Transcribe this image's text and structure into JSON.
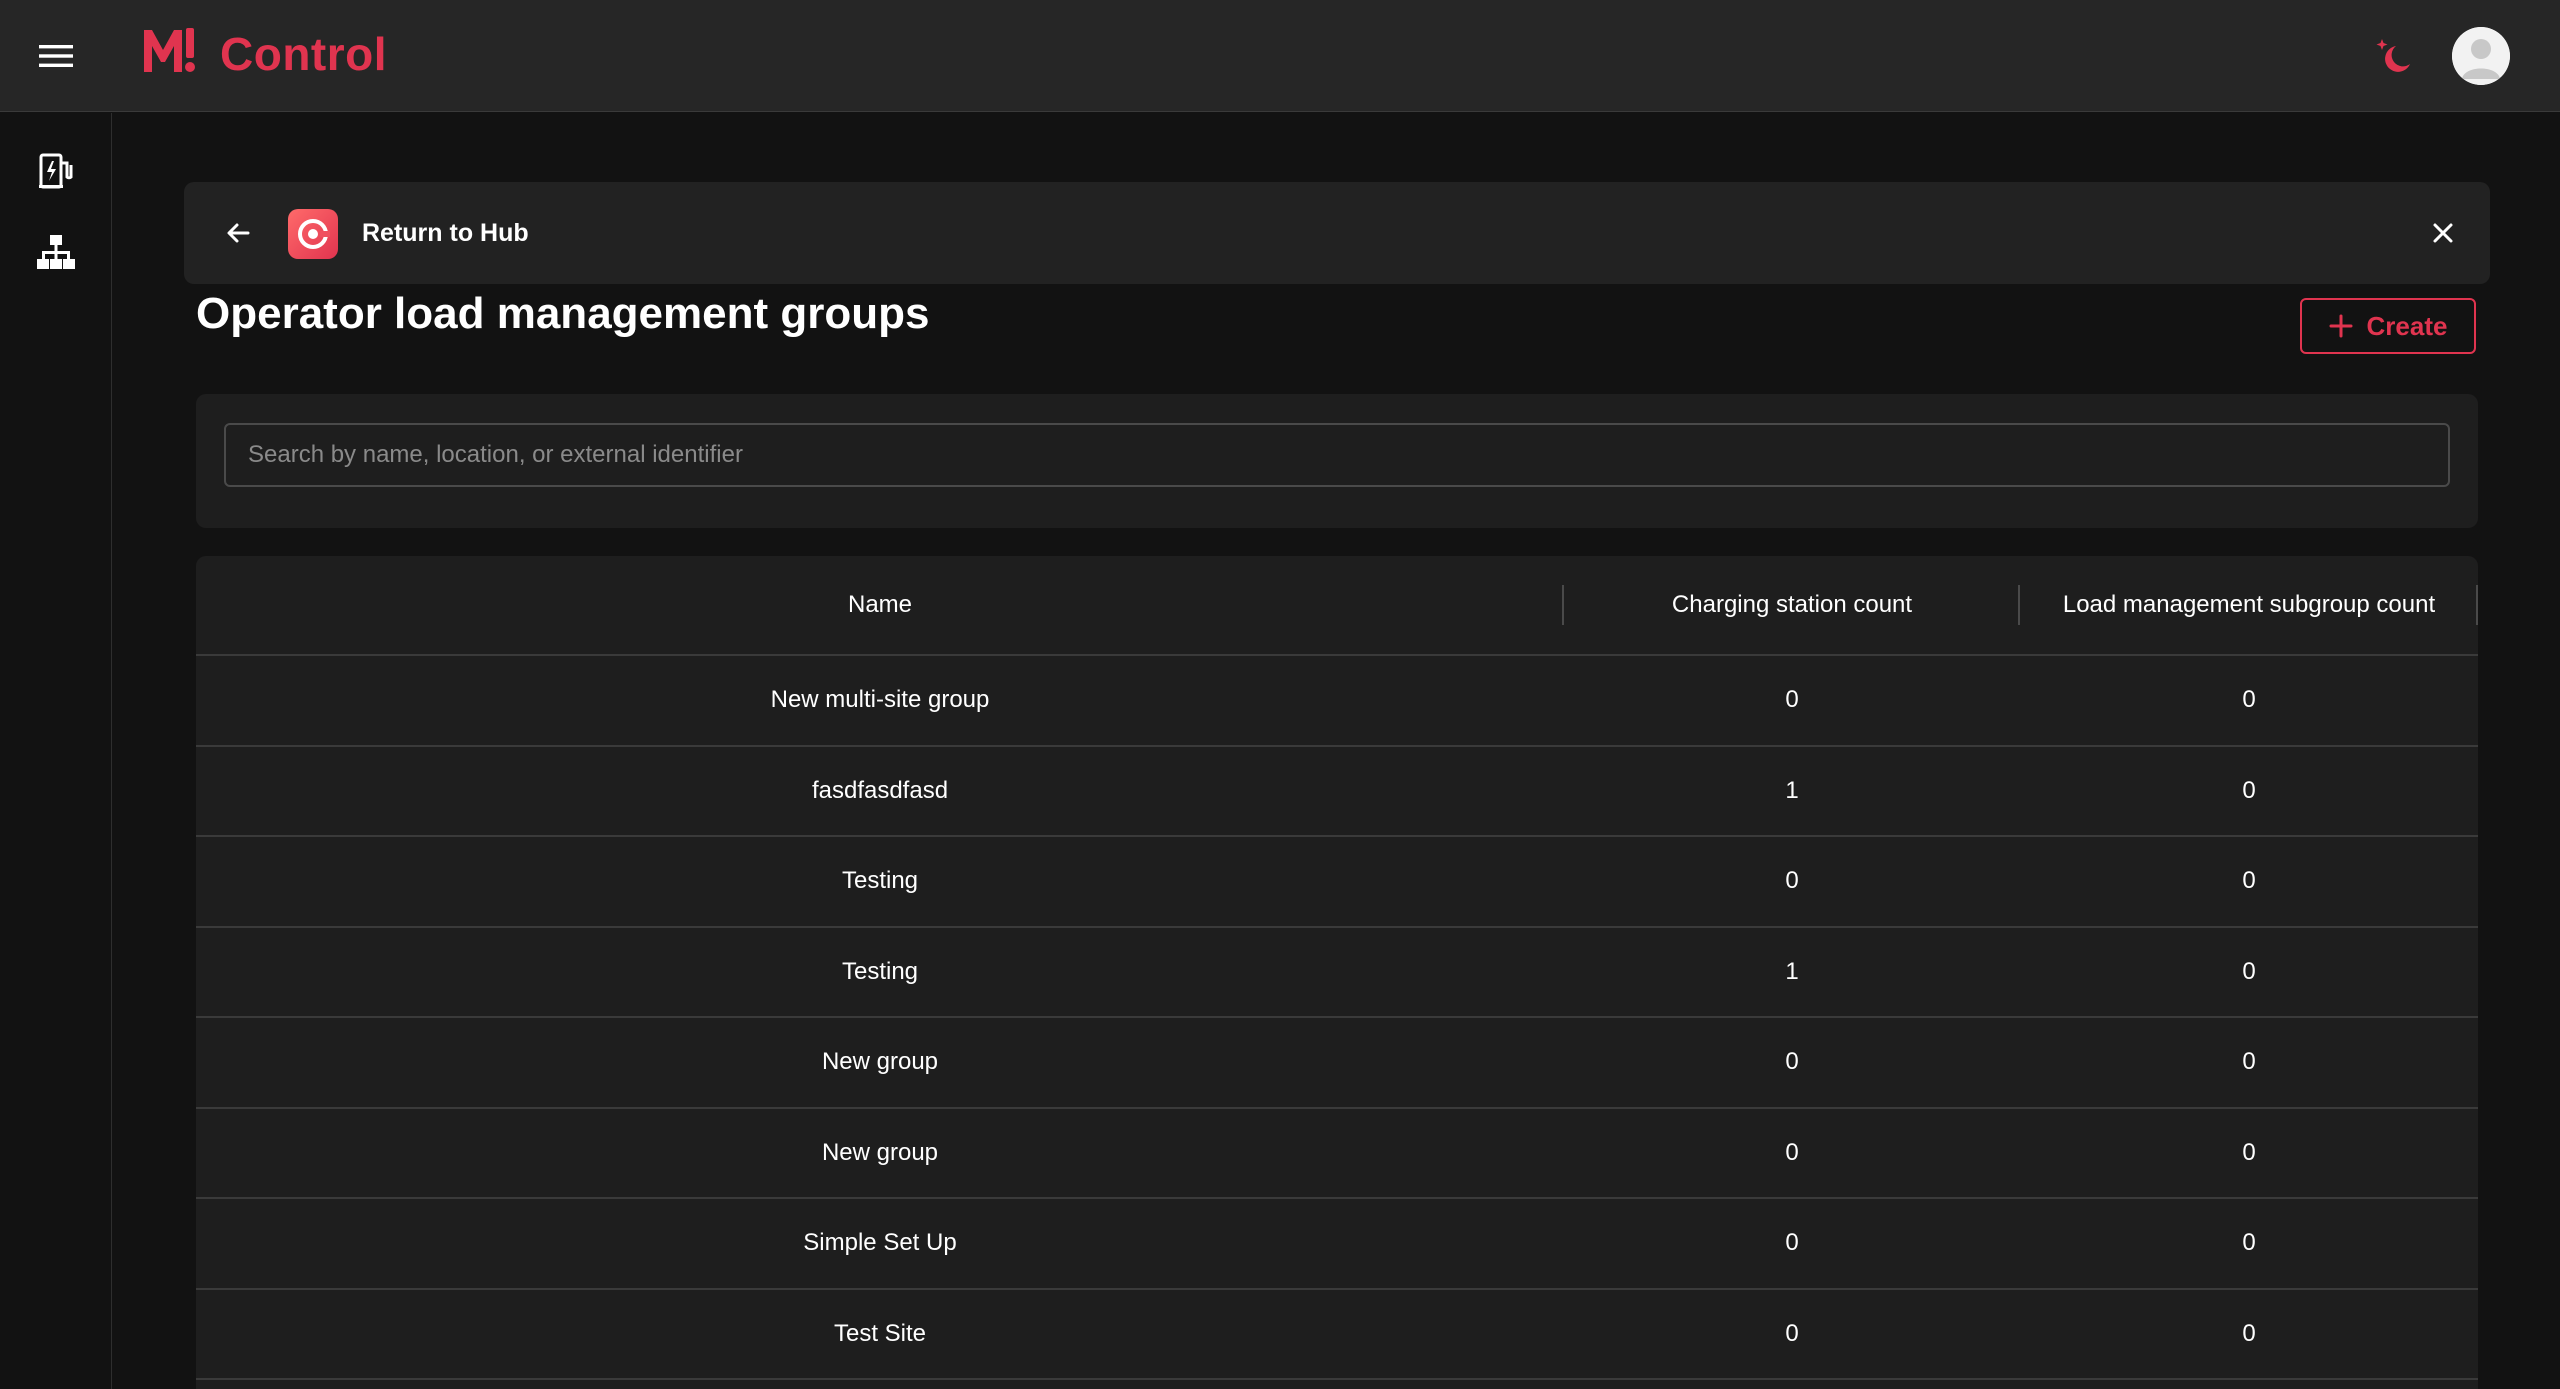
{
  "app": {
    "brand_name": "Control",
    "brand_color": "#e0344f",
    "icons": {
      "menu": "hamburger-menu-icon",
      "theme": "moon-sparkle-icon",
      "avatar": "user-avatar-icon",
      "nav_chargers": "charging-station-icon",
      "nav_groups": "hierarchy-icon"
    }
  },
  "hub_bar": {
    "back_icon": "arrow-left-icon",
    "label": "Return to Hub",
    "close_icon": "close-icon"
  },
  "page": {
    "title": "Operator load management groups",
    "create_label": "Create"
  },
  "search": {
    "placeholder": "Search by name, location, or external identifier",
    "value": ""
  },
  "table": {
    "columns": [
      "Name",
      "Charging station count",
      "Load management subgroup count"
    ],
    "rows": [
      {
        "name": "New multi-site group",
        "stations": "0",
        "subgroups": "0"
      },
      {
        "name": "fasdfasdfasd",
        "stations": "1",
        "subgroups": "0"
      },
      {
        "name": "Testing",
        "stations": "0",
        "subgroups": "0"
      },
      {
        "name": "Testing",
        "stations": "1",
        "subgroups": "0"
      },
      {
        "name": "New group",
        "stations": "0",
        "subgroups": "0"
      },
      {
        "name": "New group",
        "stations": "0",
        "subgroups": "0"
      },
      {
        "name": "Simple Set Up",
        "stations": "0",
        "subgroups": "0"
      },
      {
        "name": "Test Site",
        "stations": "0",
        "subgroups": "0"
      }
    ]
  }
}
